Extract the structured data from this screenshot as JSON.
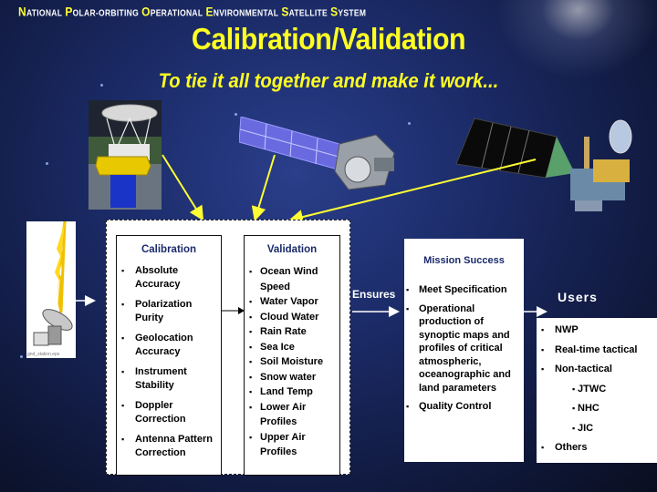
{
  "header": {
    "system_words": [
      {
        "cap": "N",
        "rest": "ational"
      },
      {
        "cap": "P",
        "rest": "olar-orbiting"
      },
      {
        "cap": "O",
        "rest": "perational"
      },
      {
        "cap": "E",
        "rest": "nvironmental"
      },
      {
        "cap": "S",
        "rest": "atellite"
      },
      {
        "cap": "S",
        "rest": "ystem"
      }
    ],
    "title": "Calibration/Validation",
    "subtitle": "To tie it all together and make it work..."
  },
  "images": {
    "satellite_left": "satellite with dish antenna",
    "satellite_center": "satellite with solar array",
    "satellite_right": "satellite with black solar panel",
    "ground_station": "ground station dish",
    "ground_station_caption": "gnd_station.eps"
  },
  "calibration": {
    "title": "Calibration",
    "items": [
      "Absolute Accuracy",
      "Polarization Purity",
      "Geolocation Accuracy",
      "Instrument Stability",
      "Doppler Correction",
      "Antenna Pattern Correction"
    ]
  },
  "validation": {
    "title": "Validation",
    "items": [
      "Ocean Wind Speed",
      "Water Vapor",
      "Cloud Water",
      "Rain Rate",
      "Sea Ice",
      "Soil Moisture",
      "Snow water",
      "Land Temp",
      "Lower Air Profiles",
      "Upper Air Profiles"
    ]
  },
  "ensures_label": "Ensures",
  "mission": {
    "title": "Mission Success",
    "items": [
      "Meet Specification",
      "Operational production of synoptic maps and profiles of critical atmospheric, oceanographic and land parameters",
      "Quality Control"
    ]
  },
  "users": {
    "title": "Users",
    "items": [
      {
        "label": "NWP",
        "sub": false
      },
      {
        "label": "Real-time tactical",
        "sub": false
      },
      {
        "label": "Non-tactical",
        "sub": false
      },
      {
        "label": "JTWC",
        "sub": true
      },
      {
        "label": "NHC",
        "sub": true
      },
      {
        "label": "JIC",
        "sub": true
      },
      {
        "label": "Others",
        "sub": false
      }
    ]
  },
  "colors": {
    "title_yellow": "#ffff22",
    "box_title_navy": "#1a2a6c",
    "arrow_yellow": "#ffff33"
  }
}
